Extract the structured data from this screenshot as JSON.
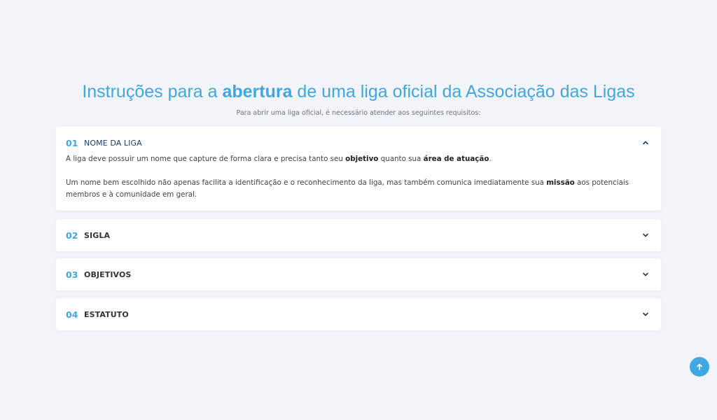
{
  "header": {
    "title_pre": "Instruções para a ",
    "title_bold": "abertura",
    "title_post": " de uma liga oficial da Associação das Ligas",
    "subtitle": "Para abrir uma liga oficial, é necessário atender aos seguintes requisitos:"
  },
  "faq": [
    {
      "number": "01",
      "title": "NOME DA LIGA",
      "expanded": true,
      "p1_a": "A liga deve possuir um nome que capture de forma clara e precisa tanto seu ",
      "p1_b": "objetivo",
      "p1_c": " quanto sua ",
      "p1_d": "área de atuação",
      "p1_e": ".",
      "p2_a": "Um nome bem escolhido não apenas facilita a identificação e o reconhecimento da liga, mas também comunica imediatamente sua ",
      "p2_b": "missão",
      "p2_c": " aos potenciais membros e à comunidade em geral."
    },
    {
      "number": "02",
      "title": "SIGLA",
      "expanded": false
    },
    {
      "number": "03",
      "title": "OBJETIVOS",
      "expanded": false
    },
    {
      "number": "04",
      "title": "ESTATUTO",
      "expanded": false
    }
  ],
  "icons": {
    "chevron_up": "chevron-up-icon",
    "chevron_down": "chevron-down-icon",
    "scroll_top": "arrow-up-icon"
  },
  "colors": {
    "accent": "#3fa7e2",
    "background": "#f2f4fa",
    "active_title": "#1a3a6e"
  }
}
